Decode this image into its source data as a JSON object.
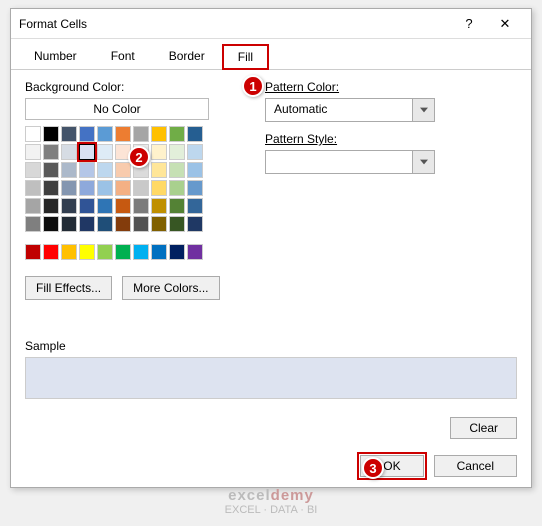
{
  "dialog": {
    "title": "Format Cells",
    "help_icon": "?",
    "close_icon": "✕"
  },
  "tabs": {
    "items": [
      "Number",
      "Font",
      "Border",
      "Fill"
    ],
    "active": "Fill"
  },
  "fill": {
    "bg_label": "Background Color:",
    "no_color": "No Color",
    "fill_effects": "Fill Effects...",
    "more_colors": "More Colors...",
    "pattern_color_label": "Pattern Color:",
    "pattern_color_value": "Automatic",
    "pattern_style_label": "Pattern Style:",
    "sample_label": "Sample",
    "sample_color": "#dde3f0"
  },
  "palette_theme": [
    [
      "#ffffff",
      "#000000",
      "#44546a",
      "#4472c4",
      "#5b9bd5",
      "#ed7d31",
      "#a5a5a5",
      "#ffc000",
      "#70ad47",
      "#255e91"
    ],
    [
      "#f2f2f2",
      "#7f7f7f",
      "#d6dce4",
      "#d9e1f2",
      "#deebf6",
      "#fce4d6",
      "#ededed",
      "#fff2cc",
      "#e2efda",
      "#bdd7ee"
    ],
    [
      "#d8d8d8",
      "#595959",
      "#acb9ca",
      "#b4c6e7",
      "#bdd7ee",
      "#f8cbad",
      "#dbdbdb",
      "#ffe699",
      "#c6e0b4",
      "#9bc2e6"
    ],
    [
      "#bfbfbf",
      "#3f3f3f",
      "#8496b0",
      "#8ea9db",
      "#9bc2e6",
      "#f4b084",
      "#c9c9c9",
      "#ffd966",
      "#a9d08e",
      "#6699cc"
    ],
    [
      "#a5a5a5",
      "#262626",
      "#323e4f",
      "#305496",
      "#2f75b5",
      "#c65911",
      "#7b7b7b",
      "#bf8f00",
      "#548235",
      "#336699"
    ],
    [
      "#7f7f7f",
      "#0c0c0c",
      "#222b35",
      "#203764",
      "#1f4e78",
      "#833c0c",
      "#525252",
      "#806000",
      "#375623",
      "#1f3864"
    ]
  ],
  "palette_standard": [
    "#c00000",
    "#ff0000",
    "#ffc000",
    "#ffff00",
    "#92d050",
    "#00b050",
    "#00b0f0",
    "#0070c0",
    "#002060",
    "#7030a0"
  ],
  "selected_swatch": {
    "row": 1,
    "col": 3
  },
  "buttons": {
    "clear": "Clear",
    "ok": "OK",
    "cancel": "Cancel"
  },
  "markers": {
    "m1": "1",
    "m2": "2",
    "m3": "3"
  },
  "watermark": {
    "brand_a": "excel",
    "brand_b": "demy",
    "tag": "EXCEL · DATA · BI"
  }
}
